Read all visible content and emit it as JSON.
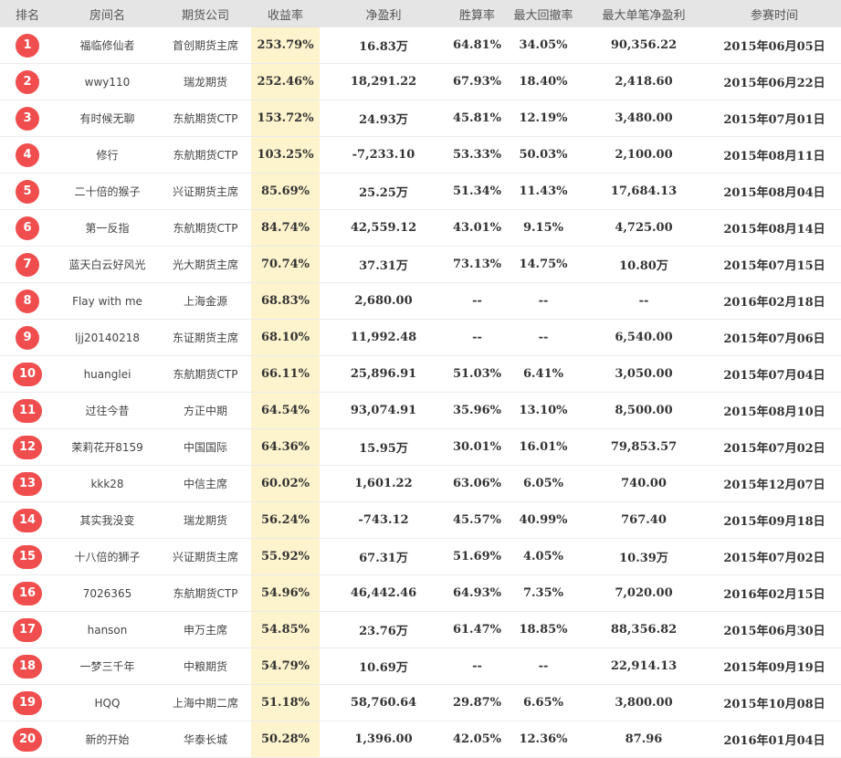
{
  "headers": [
    "排名",
    "房间名",
    "期货公司",
    "收益率",
    "净盈利",
    "胜算率",
    "最大回撤率",
    "最大单笔净盈利",
    "参赛时间"
  ],
  "rows": [
    {
      "rank": "1",
      "room": "福临修仙者",
      "company": "首创期货主席",
      "yield": "253.79%",
      "net": "16.83万",
      "win": "64.81%",
      "drawdown": "34.05%",
      "max_single": "90,356.22",
      "date": "2015年06月05日"
    },
    {
      "rank": "2",
      "room": "wwy110",
      "company": "瑞龙期货",
      "yield": "252.46%",
      "net": "18,291.22",
      "win": "67.93%",
      "drawdown": "18.40%",
      "max_single": "2,418.60",
      "date": "2015年06月22日"
    },
    {
      "rank": "3",
      "room": "有时候无聊",
      "company": "东航期货CTP",
      "yield": "153.72%",
      "net": "24.93万",
      "win": "45.81%",
      "drawdown": "12.19%",
      "max_single": "3,480.00",
      "date": "2015年07月01日"
    },
    {
      "rank": "4",
      "room": "修行",
      "company": "东航期货CTP",
      "yield": "103.25%",
      "net": "-7,233.10",
      "win": "53.33%",
      "drawdown": "50.03%",
      "max_single": "2,100.00",
      "date": "2015年08月11日"
    },
    {
      "rank": "5",
      "room": "二十倍的猴子",
      "company": "兴证期货主席",
      "yield": "85.69%",
      "net": "25.25万",
      "win": "51.34%",
      "drawdown": "11.43%",
      "max_single": "17,684.13",
      "date": "2015年08月04日"
    },
    {
      "rank": "6",
      "room": "第一反指",
      "company": "东航期货CTP",
      "yield": "84.74%",
      "net": "42,559.12",
      "win": "43.01%",
      "drawdown": "9.15%",
      "max_single": "4,725.00",
      "date": "2015年08月14日"
    },
    {
      "rank": "7",
      "room": "蓝天白云好风光",
      "company": "光大期货主席",
      "yield": "70.74%",
      "net": "37.31万",
      "win": "73.13%",
      "drawdown": "14.75%",
      "max_single": "10.80万",
      "date": "2015年07月15日"
    },
    {
      "rank": "8",
      "room": "Flay with me",
      "company": "上海金源",
      "yield": "68.83%",
      "net": "2,680.00",
      "win": "--",
      "drawdown": "--",
      "max_single": "--",
      "date": "2016年02月18日"
    },
    {
      "rank": "9",
      "room": "ljj20140218",
      "company": "东证期货主席",
      "yield": "68.10%",
      "net": "11,992.48",
      "win": "--",
      "drawdown": "--",
      "max_single": "6,540.00",
      "date": "2015年07月06日"
    },
    {
      "rank": "10",
      "room": "huanglei",
      "company": "东航期货CTP",
      "yield": "66.11%",
      "net": "25,896.91",
      "win": "51.03%",
      "drawdown": "6.41%",
      "max_single": "3,050.00",
      "date": "2015年07月04日"
    },
    {
      "rank": "11",
      "room": "过往今昔",
      "company": "方正中期",
      "yield": "64.54%",
      "net": "93,074.91",
      "win": "35.96%",
      "drawdown": "13.10%",
      "max_single": "8,500.00",
      "date": "2015年08月10日"
    },
    {
      "rank": "12",
      "room": "茉莉花开8159",
      "company": "中国国际",
      "yield": "64.36%",
      "net": "15.95万",
      "win": "30.01%",
      "drawdown": "16.01%",
      "max_single": "79,853.57",
      "date": "2015年07月02日"
    },
    {
      "rank": "13",
      "room": "kkk28",
      "company": "中信主席",
      "yield": "60.02%",
      "net": "1,601.22",
      "win": "63.06%",
      "drawdown": "6.05%",
      "max_single": "740.00",
      "date": "2015年12月07日"
    },
    {
      "rank": "14",
      "room": "其实我没变",
      "company": "瑞龙期货",
      "yield": "56.24%",
      "net": "-743.12",
      "win": "45.57%",
      "drawdown": "40.99%",
      "max_single": "767.40",
      "date": "2015年09月18日"
    },
    {
      "rank": "15",
      "room": "十八倍的狮子",
      "company": "兴证期货主席",
      "yield": "55.92%",
      "net": "67.31万",
      "win": "51.69%",
      "drawdown": "4.05%",
      "max_single": "10.39万",
      "date": "2015年07月02日"
    },
    {
      "rank": "16",
      "room": "7026365",
      "company": "东航期货CTP",
      "yield": "54.96%",
      "net": "46,442.46",
      "win": "64.93%",
      "drawdown": "7.35%",
      "max_single": "7,020.00",
      "date": "2016年02月15日"
    },
    {
      "rank": "17",
      "room": "hanson",
      "company": "申万主席",
      "yield": "54.85%",
      "net": "23.76万",
      "win": "61.47%",
      "drawdown": "18.85%",
      "max_single": "88,356.82",
      "date": "2015年06月30日"
    },
    {
      "rank": "18",
      "room": "一梦三千年",
      "company": "中粮期货",
      "yield": "54.79%",
      "net": "10.69万",
      "win": "--",
      "drawdown": "--",
      "max_single": "22,914.13",
      "date": "2015年09月19日"
    },
    {
      "rank": "19",
      "room": "HQQ",
      "company": "上海中期二席",
      "yield": "51.18%",
      "net": "58,760.64",
      "win": "29.87%",
      "drawdown": "6.65%",
      "max_single": "3,800.00",
      "date": "2015年10月08日"
    },
    {
      "rank": "20",
      "room": "新的开始",
      "company": "华泰长城",
      "yield": "50.28%",
      "net": "1,396.00",
      "win": "42.05%",
      "drawdown": "12.36%",
      "max_single": "87.96",
      "date": "2016年01月04日"
    }
  ]
}
